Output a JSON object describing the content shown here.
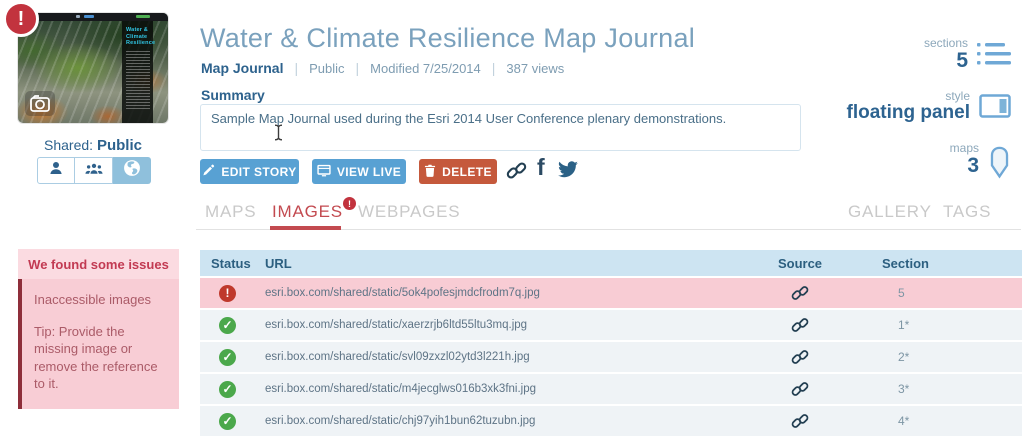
{
  "colors": {
    "accent_blue": "#58a1d3",
    "delete_orange": "#c5593c",
    "alert_red": "#c2333e",
    "ok_green": "#4ba84b",
    "tab_active_red": "#c34a50",
    "table_header_blue": "#cde4f2",
    "issue_pink": "#f8cdd5"
  },
  "glyphs": {
    "alert": "!",
    "ok_check": "✓",
    "facebook": "f"
  },
  "thumbnail": {
    "overlay_title": "Water & Climate Resilience",
    "shared_label": "Shared:",
    "shared_value": "Public"
  },
  "header": {
    "title": "Water & Climate Resilience Map Journal",
    "type": "Map Journal",
    "separator": "|",
    "visibility": "Public",
    "modified": "Modified 7/25/2014",
    "views": "387 views",
    "summary_label": "Summary",
    "summary_text": "Sample Map Journal used during the Esri 2014 User Conference plenary demonstrations."
  },
  "toolbar": {
    "edit_label": "EDIT STORY",
    "view_label": "VIEW LIVE",
    "delete_label": "DELETE"
  },
  "stats": [
    {
      "label": "sections",
      "value": "5"
    },
    {
      "label": "style",
      "value": "floating panel"
    },
    {
      "label": "maps",
      "value": "3"
    }
  ],
  "tabs": {
    "items": [
      {
        "label": "MAPS"
      },
      {
        "label": "IMAGES",
        "badge": "!"
      },
      {
        "label": "WEBPAGES"
      },
      {
        "label": "GALLERY"
      },
      {
        "label": "TAGS"
      }
    ]
  },
  "issues_panel": {
    "title": "We found some issues",
    "issue": "Inaccessible images",
    "tip": "Tip: Provide the missing image or remove the reference to it."
  },
  "table": {
    "columns": [
      "Status",
      "URL",
      "Source",
      "Section"
    ],
    "rows": [
      {
        "status": "error",
        "url": "esri.box.com/shared/static/5ok4pofesjmdcfrodm7q.jpg",
        "source": "link",
        "section": "5"
      },
      {
        "status": "ok",
        "url": "esri.box.com/shared/static/xaerzrjb6ltd55ltu3mq.jpg",
        "source": "link",
        "section": "1*"
      },
      {
        "status": "ok",
        "url": "esri.box.com/shared/static/svl09zxzl02ytd3l221h.jpg",
        "source": "link",
        "section": "2*"
      },
      {
        "status": "ok",
        "url": "esri.box.com/shared/static/m4jecglws016b3xk3fni.jpg",
        "source": "link",
        "section": "3*"
      },
      {
        "status": "ok",
        "url": "esri.box.com/shared/static/chj97yih1bun62tuzubn.jpg",
        "source": "link",
        "section": "4*"
      }
    ]
  }
}
